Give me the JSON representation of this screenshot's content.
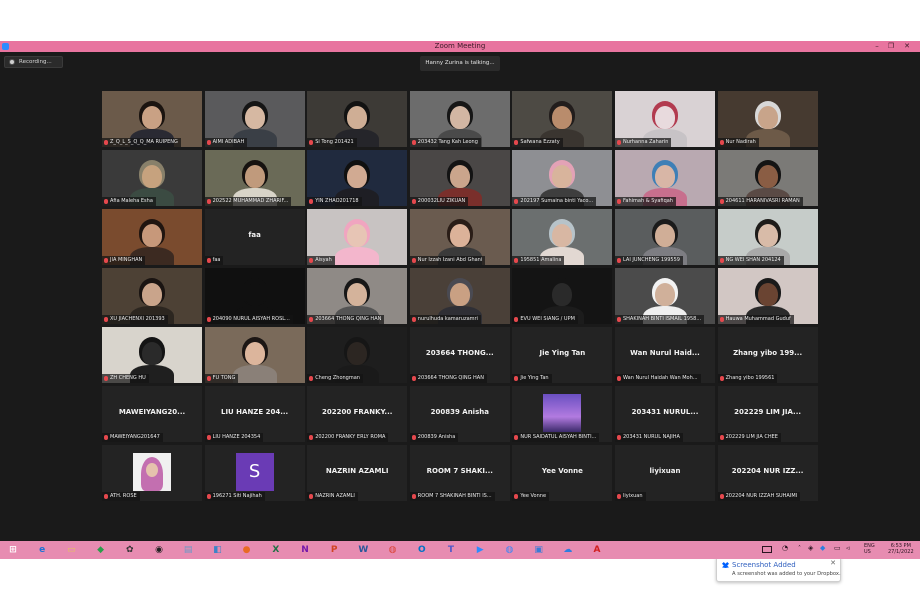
{
  "window": {
    "title": "Zoom Meeting",
    "minimize": "–",
    "maximize": "❐",
    "close": "✕"
  },
  "recording_label": "Recording...",
  "talking_indicator": "Hanny Zurina is talking...",
  "tiles": [
    {
      "name": "Z_Q_L_S_Q_Q_MA RUIPENG",
      "bg": "#6b5a4a",
      "skin": "#c9a184",
      "hair": "#1b1410",
      "shirt": "#2a2a33"
    },
    {
      "name": "AIMI ADIBAH",
      "bg": "#5a5a5c",
      "skin": "#d6b8a2",
      "hair": "#151515",
      "shirt": "#3a3f46"
    },
    {
      "name": "Si Tong 201421",
      "bg": "#3d3a36",
      "skin": "#cfae95",
      "hair": "#121212",
      "shirt": "#25252a"
    },
    {
      "name": "203432 Tang Kah Leong",
      "bg": "#6c6c6c",
      "skin": "#d2b6a3",
      "hair": "#161616",
      "shirt": "#4a4a4a"
    },
    {
      "name": "Safwana Ezzaty",
      "bg": "#4d4a44",
      "skin": "#b98c6c",
      "hair": "#221d1c",
      "shirt": "#3a3530"
    },
    {
      "name": "Nurhanna Zaharin",
      "bg": "#d9d2d4",
      "skin": "#e8dadd",
      "hair": "#b23b4f",
      "shirt": "#c7c3c6"
    },
    {
      "name": "Nur Nadirah",
      "bg": "#463a30",
      "skin": "#c8a48a",
      "hair": "#d8d8d8",
      "shirt": "#6d5a48"
    },
    {
      "name": "Afia Maleha Esha",
      "bg": "#3a3a3a",
      "skin": "#c6a27e",
      "hair": "#88806a",
      "shirt": "#3b4b42"
    },
    {
      "name": "202522 MUHAMMAD ZHARIF...",
      "bg": "#6a6a57",
      "skin": "#c09a7c",
      "hair": "#161210",
      "shirt": "#d8d4c8"
    },
    {
      "name": "YIN ZHAO201718",
      "bg": "#202a3e",
      "skin": "#d1aa92",
      "hair": "#101010",
      "shirt": "#1e1e24"
    },
    {
      "name": "200032LIU ZIKUAN",
      "bg": "#4a4746",
      "skin": "#caa58c",
      "hair": "#131313",
      "shirt": "#7a2f2b"
    },
    {
      "name": "202197 Sumaina binti Yaco...",
      "bg": "#8e8f93",
      "skin": "#d8b49c",
      "hair": "#e3a2b6",
      "shirt": "#3e3e3e"
    },
    {
      "name": "Fahimah & Syafiqah",
      "bg": "#b9a9b1",
      "skin": "#d8b6a6",
      "hair": "#3e7fb6",
      "shirt": "#c76f8d"
    },
    {
      "name": "204611 HARANIVASRI RAMAN",
      "bg": "#7b7a77",
      "skin": "#8a5d44",
      "hair": "#141414",
      "shirt": "#5a4a45"
    },
    {
      "name": "JIA MINGHAN",
      "bg": "#7a4b2e",
      "skin": "#c7987a",
      "hair": "#201510",
      "shirt": "#3c2a21"
    },
    {
      "name": "faa",
      "big": "faa",
      "bg": "#232323"
    },
    {
      "name": "Aisyah",
      "bg": "#c8c3c2",
      "skin": "#e7c5b5",
      "hair": "#f0a5c0",
      "shirt": "#f3b6cc"
    },
    {
      "name": "Nur Izzah Izani Abd Ghani",
      "bg": "#6a5b4f",
      "skin": "#dcb299",
      "hair": "#2a1d17",
      "shirt": "#3a3a3a"
    },
    {
      "name": "195851 Amalina",
      "bg": "#6b6f6f",
      "skin": "#d8b7a3",
      "hair": "#b7c3c9",
      "shirt": "#e2d8d2"
    },
    {
      "name": "LAI JUNCHENG 199559",
      "bg": "#5a5d5e",
      "skin": "#d0ae97",
      "hair": "#1b1b1b",
      "shirt": "#7d7d82"
    },
    {
      "name": "NG WEI SHAN 204124",
      "bg": "#c6ccc9",
      "skin": "#d8bba8",
      "hair": "#1e1c1a",
      "shirt": "#a9a9a9"
    },
    {
      "name": "XU JIACHENXI 201393",
      "bg": "#4d4135",
      "skin": "#c9a48b",
      "hair": "#1a1412",
      "shirt": "#2c2620"
    },
    {
      "name": "204090 NURUL AISYAH ROSL...",
      "bg": "#101010",
      "skin": "#101010",
      "hair": "#101010",
      "shirt": "#101010"
    },
    {
      "name": "203664 THONG QING HAN",
      "bg": "#8f8a86",
      "skin": "#d4b39b",
      "hair": "#171717",
      "shirt": "#545454"
    },
    {
      "name": "nurulhuda kamaruzamri",
      "bg": "#4a4038",
      "skin": "#c9a083",
      "hair": "#4a4a52",
      "shirt": "#2f2f35"
    },
    {
      "name": "EVU WEI SIANG / UPM",
      "bg": "#141414",
      "skin": "#2a2a2a",
      "hair": "#141414",
      "shirt": "#1c1c1c"
    },
    {
      "name": "SHAKINAH BINTI ISMAIL 1958...",
      "bg": "#4b4b4b",
      "skin": "#d0b09a",
      "hair": "#f2f2f2",
      "shirt": "#efefef"
    },
    {
      "name": "Hauwa Muhammad Guduf",
      "bg": "#d2c7c4",
      "skin": "#6a4432",
      "hair": "#1a1a1a",
      "shirt": "#2a2a2a"
    },
    {
      "name": "ZH CHENG HU",
      "bg": "#d8d4cc",
      "skin": "#2a2a2a",
      "hair": "#141414",
      "shirt": "#1f1f1f"
    },
    {
      "name": "FU TONG",
      "bg": "#7a6a5a",
      "skin": "#dcb59c",
      "hair": "#1c1614",
      "shirt": "#8a8078"
    },
    {
      "name": "Cheng Zhongman",
      "bg": "#1e1e1e",
      "skin": "#2c2622",
      "hair": "#161616",
      "shirt": "#1a1a1a"
    },
    {
      "name": "203664 THONG QING HAN",
      "big": "203664 THONG...",
      "bg": "#232323"
    },
    {
      "name": "Jie Ying Tan",
      "big": "Jie Ying Tan",
      "bg": "#232323"
    },
    {
      "name": "Wan Nurul Haidah Wan Moh...",
      "big": "Wan Nurul Haid...",
      "bg": "#232323"
    },
    {
      "name": "Zhang yibo 199561",
      "big": "Zhang yibo 199...",
      "bg": "#232323"
    },
    {
      "name": "MAWEIYANG201647",
      "big": "MAWEIYANG20...",
      "bg": "#232323"
    },
    {
      "name": "LIU HANZE 204354",
      "big": "LIU HANZE 204...",
      "bg": "#232323"
    },
    {
      "name": "202200 FRANKY ERLY ROMA",
      "big": "202200 FRANKY...",
      "bg": "#232323"
    },
    {
      "name": "200839 Anisha",
      "big": "200839 Anisha",
      "bg": "#232323"
    },
    {
      "name": "NUR SAIDATUL AISYAH BINTI...",
      "pic": "city",
      "bg": "#232323"
    },
    {
      "name": "203431 NURUL NAJIHA",
      "big": "203431 NURUL...",
      "bg": "#232323"
    },
    {
      "name": "202229 LIM JIA CHEE",
      "big": "202229 LIM JIA...",
      "bg": "#232323"
    },
    {
      "name": "ATH. ROSE",
      "pic": "portrait",
      "bg": "#232323"
    },
    {
      "name": "196271 Siti Najihah",
      "avatar": "S",
      "avatar_color": "#6a3bb5",
      "bg": "#232323"
    },
    {
      "name": "NAZRIN AZAMLI",
      "big": "NAZRIN AZAMLI",
      "bg": "#232323"
    },
    {
      "name": "ROOM 7 SHAKINAH BINTI IS...",
      "big": "ROOM 7 SHAKI...",
      "bg": "#232323"
    },
    {
      "name": "Yee Vonne",
      "big": "Yee Vonne",
      "bg": "#232323"
    },
    {
      "name": "liyixuan",
      "big": "liyixuan",
      "bg": "#232323"
    },
    {
      "name": "202204 NUR IZZAH SUHAIMI",
      "big": "202204 NUR IZZ...",
      "bg": "#232323"
    }
  ],
  "toast": {
    "title": "Screenshot Added",
    "message": "A screenshot was added to your Dropbox.",
    "close": "✕"
  },
  "tray": {
    "lang": "ENG",
    "region": "US",
    "time": "6:53 PM",
    "date": "27/1/2022"
  },
  "taskbar_icons": [
    {
      "name": "start-icon",
      "glyph": "⊞",
      "color": "#ffffff"
    },
    {
      "name": "ie-icon",
      "glyph": "e",
      "color": "#1e73d6"
    },
    {
      "name": "file-explorer-icon",
      "glyph": "▭",
      "color": "#e6c55a"
    },
    {
      "name": "app-green-icon",
      "glyph": "◆",
      "color": "#2a9d4a"
    },
    {
      "name": "paint-icon",
      "glyph": "✿",
      "color": "#333333"
    },
    {
      "name": "camera-icon",
      "glyph": "◉",
      "color": "#222222"
    },
    {
      "name": "notepad-icon",
      "glyph": "▤",
      "color": "#6b9ac7"
    },
    {
      "name": "app-blue-icon",
      "glyph": "◧",
      "color": "#3d84c7"
    },
    {
      "name": "firefox-icon",
      "glyph": "●",
      "color": "#e86a24"
    },
    {
      "name": "excel-icon",
      "glyph": "X",
      "color": "#1e7145"
    },
    {
      "name": "onenote-icon",
      "glyph": "N",
      "color": "#7719aa"
    },
    {
      "name": "powerpoint-icon",
      "glyph": "P",
      "color": "#d04423"
    },
    {
      "name": "word-icon",
      "glyph": "W",
      "color": "#2b579a"
    },
    {
      "name": "chrome-icon",
      "glyph": "◍",
      "color": "#db4437"
    },
    {
      "name": "outlook-icon",
      "glyph": "O",
      "color": "#0072c6"
    },
    {
      "name": "teams-icon",
      "glyph": "T",
      "color": "#5059c9"
    },
    {
      "name": "zoom-icon",
      "glyph": "▶",
      "color": "#2d8cff"
    },
    {
      "name": "chrome-alt-icon",
      "glyph": "◍",
      "color": "#4285f4"
    },
    {
      "name": "photos-icon",
      "glyph": "▣",
      "color": "#3a7bd5"
    },
    {
      "name": "onedrive-icon",
      "glyph": "☁",
      "color": "#2d7ee0"
    },
    {
      "name": "acrobat-icon",
      "glyph": "A",
      "color": "#d11f1f"
    }
  ]
}
